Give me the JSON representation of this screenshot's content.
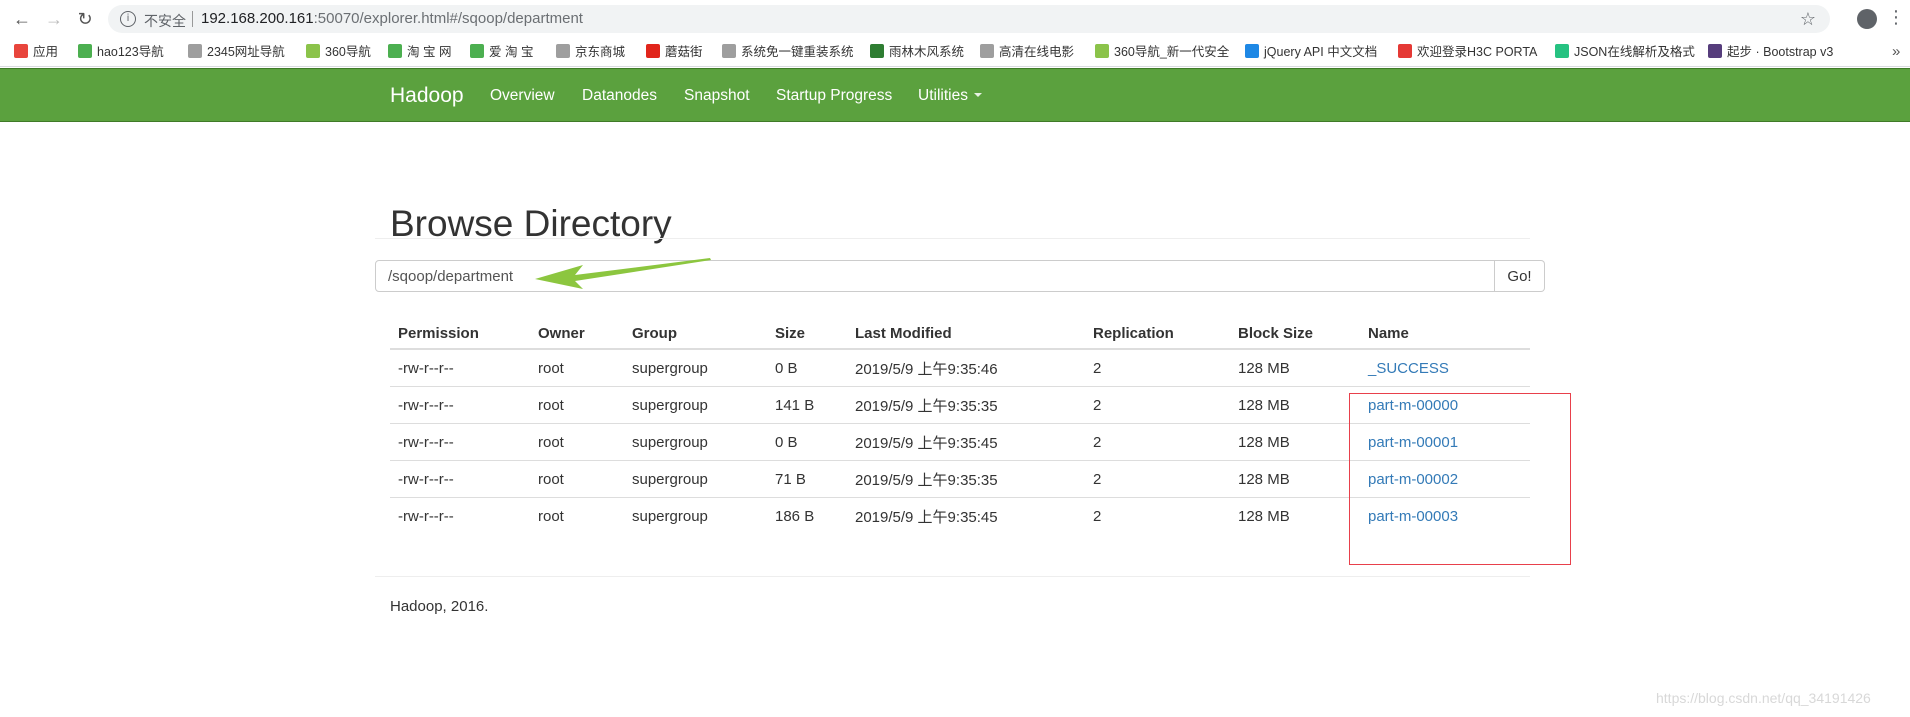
{
  "browser": {
    "insecure_label": "不安全",
    "url_host": "192.168.200.161",
    "url_rest": ":50070/explorer.html#/sqoop/department",
    "bookmarks": [
      {
        "label": "应用",
        "icon": "apps-grid-icon",
        "color": "#e8453c"
      },
      {
        "label": "hao123导航",
        "icon": "hao123-icon",
        "color": "#4caf50"
      },
      {
        "label": "2345网址导航",
        "icon": "page-icon",
        "color": "#9e9e9e"
      },
      {
        "label": "360导航",
        "icon": "360-icon",
        "color": "#8bc34a"
      },
      {
        "label": "淘 宝 网",
        "icon": "hao123-icon",
        "color": "#4caf50"
      },
      {
        "label": "爱 淘 宝",
        "icon": "hao123-icon",
        "color": "#4caf50"
      },
      {
        "label": "京东商城",
        "icon": "page-icon",
        "color": "#9e9e9e"
      },
      {
        "label": "蘑菇街",
        "icon": "jd-icon",
        "color": "#e1251b"
      },
      {
        "label": "系统免一键重装系统",
        "icon": "page-icon",
        "color": "#9e9e9e"
      },
      {
        "label": "雨林木风系统",
        "icon": "tree-icon",
        "color": "#2e7d32"
      },
      {
        "label": "高清在线电影",
        "icon": "page-icon",
        "color": "#9e9e9e"
      },
      {
        "label": "360导航_新一代安全",
        "icon": "360-icon",
        "color": "#8bc34a"
      },
      {
        "label": "jQuery API 中文文档",
        "icon": "jquery-icon",
        "color": "#1e88e5"
      },
      {
        "label": "欢迎登录H3C PORTA",
        "icon": "h3c-icon",
        "color": "#e53935"
      },
      {
        "label": "JSON在线解析及格式",
        "icon": "json-icon",
        "color": "#26c281"
      },
      {
        "label": "起步 · Bootstrap v3",
        "icon": "bootstrap-icon",
        "color": "#563d7c"
      }
    ]
  },
  "navbar": {
    "brand": "Hadoop",
    "items": [
      "Overview",
      "Datanodes",
      "Snapshot",
      "Startup Progress",
      "Utilities"
    ]
  },
  "page": {
    "title": "Browse Directory",
    "path_value": "/sqoop/department",
    "go_label": "Go!"
  },
  "table": {
    "headers": [
      "Permission",
      "Owner",
      "Group",
      "Size",
      "Last Modified",
      "Replication",
      "Block Size",
      "Name"
    ],
    "rows": [
      [
        "-rw-r--r--",
        "root",
        "supergroup",
        "0 B",
        "2019/5/9 上午9:35:46",
        "2",
        "128 MB",
        "_SUCCESS"
      ],
      [
        "-rw-r--r--",
        "root",
        "supergroup",
        "141 B",
        "2019/5/9 上午9:35:35",
        "2",
        "128 MB",
        "part-m-00000"
      ],
      [
        "-rw-r--r--",
        "root",
        "supergroup",
        "0 B",
        "2019/5/9 上午9:35:45",
        "2",
        "128 MB",
        "part-m-00001"
      ],
      [
        "-rw-r--r--",
        "root",
        "supergroup",
        "71 B",
        "2019/5/9 上午9:35:35",
        "2",
        "128 MB",
        "part-m-00002"
      ],
      [
        "-rw-r--r--",
        "root",
        "supergroup",
        "186 B",
        "2019/5/9 上午9:35:45",
        "2",
        "128 MB",
        "part-m-00003"
      ]
    ]
  },
  "footer": "Hadoop, 2016.",
  "watermark": "https://blog.csdn.net/qq_34191426",
  "colors": {
    "navbar": "#5ba13e",
    "link": "#337ab7",
    "annotation_arrow": "#8cc63f",
    "annotation_box": "#e8404b"
  }
}
